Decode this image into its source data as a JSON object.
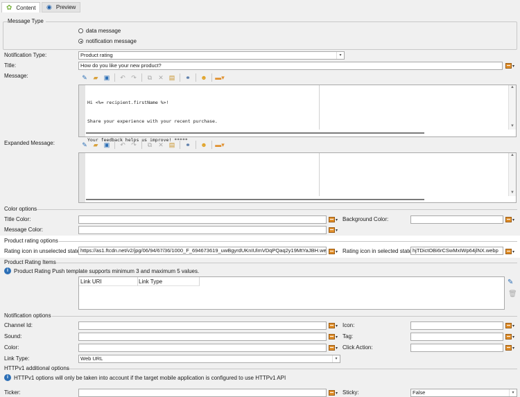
{
  "tabs": [
    {
      "label": "Content",
      "icon": "android-icon"
    },
    {
      "label": "Preview",
      "icon": "eye-icon"
    }
  ],
  "message_type": {
    "group": "Message Type",
    "options": [
      "data message",
      "notification message"
    ],
    "selected": "notification message"
  },
  "form": {
    "notification_type_label": "Notification Type:",
    "notification_type_value": "Product rating",
    "title_label": "Title:",
    "title_value": "How do you like your new product?",
    "message_label": "Message:",
    "message_lines": [
      "Hi <%= recipient.firstName %>!",
      "Share your experience with your recent purchase.",
      "Your feedback helps us improve! *****"
    ],
    "expanded_message_label": "Expanded Message:"
  },
  "color_options": {
    "group": "Color options",
    "title_color_label": "Title Color:",
    "background_color_label": "Background Color:",
    "message_color_label": "Message Color:"
  },
  "product_rating_options": {
    "group": "Product rating options",
    "unselected_label": "Rating icon in unselected state:",
    "unselected_value": "https://as1.ftcdn.net/v2/jpg/06/94/67/36/1000_F_694673619_uwBgyrdUKnIUlmVDqPQaq2y19MtYaJBH.webp",
    "selected_label": "Rating icon in selected state:",
    "selected_value": "hjTDictOBi6rCSwMxIWp64jlNX.webp"
  },
  "product_rating_items": {
    "group": "Product Rating Items",
    "info_text": "Product Rating Push template supports minimum 3 and maximum 5 values.",
    "columns": [
      "Link URI",
      "Link Type"
    ]
  },
  "notification_options": {
    "group": "Notification options",
    "channel_id_label": "Channel Id:",
    "icon_label": "Icon:",
    "sound_label": "Sound:",
    "tag_label": "Tag:",
    "color_label": "Color:",
    "click_action_label": "Click Action:",
    "link_type_label": "Link Type:",
    "link_type_value": "Web URL"
  },
  "httpv1": {
    "group": "HTTPv1 additional options",
    "info_text": "HTTPv1 options will only be taken into account if the target mobile application is configured to use HTTPv1 API",
    "ticker_label": "Ticker:",
    "sticky_label": "Sticky:",
    "sticky_value": "False"
  },
  "colors": {
    "accent_highlight": "#ffffff",
    "picker_orange": "#e08f2c",
    "info_blue": "#2c6fb6"
  }
}
